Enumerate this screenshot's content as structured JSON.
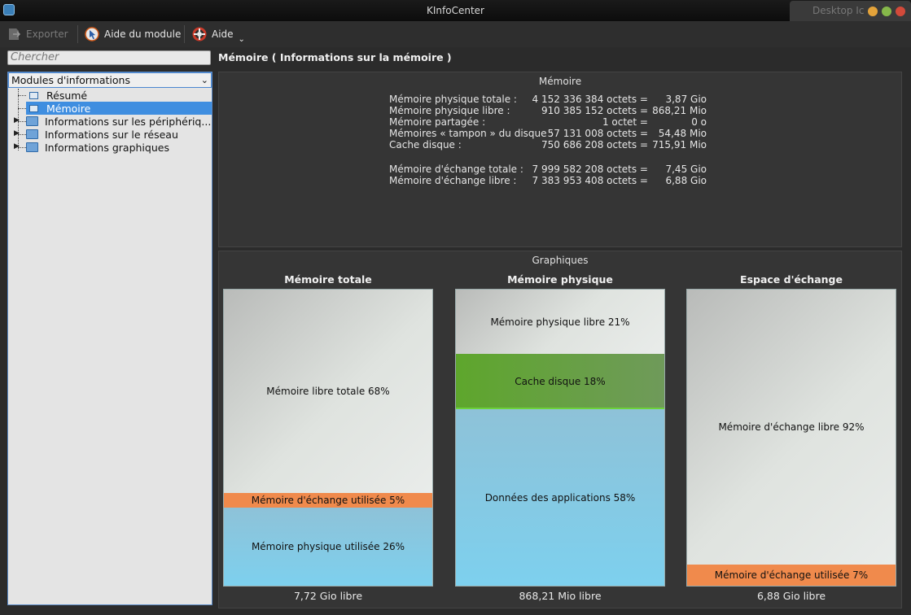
{
  "window": {
    "title": "KInfoCenter",
    "tab_label": "Desktop Ic"
  },
  "toolbar": {
    "export_label": "Exporter",
    "module_help_label": "Aide du module",
    "help_label": "Aide"
  },
  "sidebar": {
    "search_placeholder": "Chercher",
    "header": "Modules d'informations",
    "items": [
      {
        "label": "Résumé",
        "icon": "monitor-icon"
      },
      {
        "label": "Mémoire",
        "icon": "memory-icon",
        "selected": true
      },
      {
        "label": "Informations sur les périphériq...",
        "icon": "folder-icon"
      },
      {
        "label": "Informations sur le réseau",
        "icon": "folder-icon"
      },
      {
        "label": "Informations graphiques",
        "icon": "folder-icon"
      }
    ]
  },
  "main": {
    "title": "Mémoire  ( Informations sur la mémoire )",
    "memory_panel": {
      "title": "Mémoire",
      "rows": [
        {
          "label": "Mémoire physique totale :",
          "bytes": "4 152 336 384 octets =",
          "size": "3,87 Gio"
        },
        {
          "label": "Mémoire physique libre :",
          "bytes": "910 385 152 octets =",
          "size": "868,21 Mio"
        },
        {
          "label": "Mémoire partagée :",
          "bytes": "1 octet =",
          "size": "0 o"
        },
        {
          "label": "Mémoires « tampon » du disque :",
          "bytes": "57 131 008 octets =",
          "size": "54,48 Mio"
        },
        {
          "label": "Cache disque :",
          "bytes": "750 686 208 octets =",
          "size": "715,91 Mio"
        }
      ],
      "swap_rows": [
        {
          "label": "Mémoire d'échange totale :",
          "bytes": "7 999 582 208 octets =",
          "size": "7,45 Gio"
        },
        {
          "label": "Mémoire d'échange libre :",
          "bytes": "7 383 953 408 octets =",
          "size": "6,88 Gio"
        }
      ]
    },
    "graphs_panel": {
      "title": "Graphiques",
      "charts": [
        {
          "title": "Mémoire totale",
          "footer": "7,72 Gio libre",
          "segments": [
            {
              "label": "Mémoire libre totale 68%",
              "percent": 68,
              "kind": "free"
            },
            {
              "label": "Mémoire d'échange utilisée 5%",
              "percent": 5,
              "kind": "swap"
            },
            {
              "label": "Mémoire physique utilisée 26%",
              "percent": 26,
              "kind": "app"
            }
          ]
        },
        {
          "title": "Mémoire physique",
          "footer": "868,21 Mio libre",
          "segments": [
            {
              "label": "Mémoire physique libre 21%",
              "percent": 21,
              "kind": "free"
            },
            {
              "label": "Cache disque 18%",
              "percent": 18,
              "kind": "cache"
            },
            {
              "label": "Données des applications 58%",
              "percent": 58,
              "kind": "app"
            }
          ]
        },
        {
          "title": "Espace d'échange",
          "footer": "6,88 Gio libre",
          "segments": [
            {
              "label": "Mémoire d'échange libre 92%",
              "percent": 92,
              "kind": "free"
            },
            {
              "label": "Mémoire d'échange utilisée 7%",
              "percent": 7,
              "kind": "swap"
            }
          ]
        }
      ]
    }
  },
  "colors": {
    "selection": "#3f8ee0",
    "swap_used": "#f08a4c",
    "cache": "#5ea62c",
    "app_data": "#7dd0ee"
  }
}
